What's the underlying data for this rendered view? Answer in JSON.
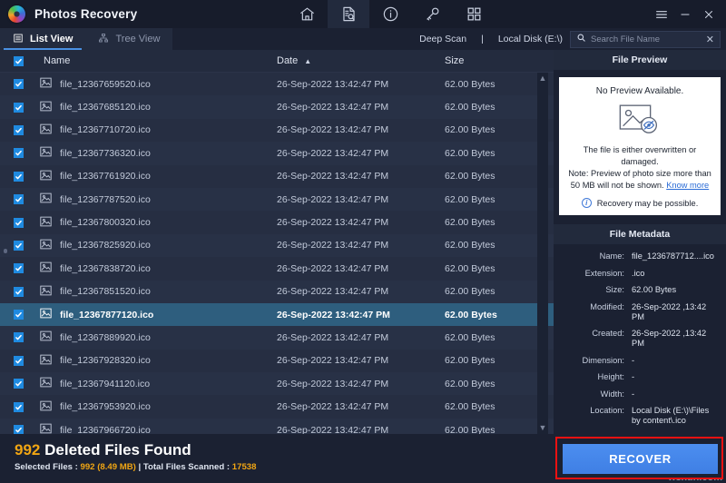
{
  "window": {
    "app_title": "Photos Recovery",
    "logo_icon": "photos-recovery-logo",
    "toolbar_icons": [
      {
        "name": "home-icon",
        "label": "Home"
      },
      {
        "name": "scan-document-icon",
        "label": "Scan",
        "active": true
      },
      {
        "name": "info-icon",
        "label": "Info"
      },
      {
        "name": "key-icon",
        "label": "Registration"
      },
      {
        "name": "grid-apps-icon",
        "label": "More Tools"
      }
    ],
    "controls": {
      "menu_label": "≡",
      "minimize_label": "–",
      "close_label": "✕"
    }
  },
  "tabs": [
    {
      "label": "List View",
      "icon": "list-view-icon",
      "active": true
    },
    {
      "label": "Tree View",
      "icon": "tree-view-icon",
      "active": false
    }
  ],
  "scanbar": {
    "scan_mode": "Deep Scan",
    "separator": "|",
    "drive": "Local Disk (E:\\)",
    "search": {
      "icon": "search-icon",
      "placeholder": "Search File Name",
      "value": "",
      "clear_label": "✕"
    }
  },
  "table": {
    "select_all_checked": true,
    "columns": {
      "name": "Name",
      "date": "Date",
      "size": "Size",
      "sort_indicator": "▲",
      "sorted_by": "Date",
      "sort_direction": "ascending"
    },
    "rows": [
      {
        "checked": true,
        "name": "file_12367659520.ico",
        "date": "26-Sep-2022 13:42:47 PM",
        "size": "62.00 Bytes",
        "selected": false
      },
      {
        "checked": true,
        "name": "file_12367685120.ico",
        "date": "26-Sep-2022 13:42:47 PM",
        "size": "62.00 Bytes",
        "selected": false
      },
      {
        "checked": true,
        "name": "file_12367710720.ico",
        "date": "26-Sep-2022 13:42:47 PM",
        "size": "62.00 Bytes",
        "selected": false
      },
      {
        "checked": true,
        "name": "file_12367736320.ico",
        "date": "26-Sep-2022 13:42:47 PM",
        "size": "62.00 Bytes",
        "selected": false
      },
      {
        "checked": true,
        "name": "file_12367761920.ico",
        "date": "26-Sep-2022 13:42:47 PM",
        "size": "62.00 Bytes",
        "selected": false
      },
      {
        "checked": true,
        "name": "file_12367787520.ico",
        "date": "26-Sep-2022 13:42:47 PM",
        "size": "62.00 Bytes",
        "selected": false
      },
      {
        "checked": true,
        "name": "file_12367800320.ico",
        "date": "26-Sep-2022 13:42:47 PM",
        "size": "62.00 Bytes",
        "selected": false
      },
      {
        "checked": true,
        "name": "file_12367825920.ico",
        "date": "26-Sep-2022 13:42:47 PM",
        "size": "62.00 Bytes",
        "selected": false
      },
      {
        "checked": true,
        "name": "file_12367838720.ico",
        "date": "26-Sep-2022 13:42:47 PM",
        "size": "62.00 Bytes",
        "selected": false
      },
      {
        "checked": true,
        "name": "file_12367851520.ico",
        "date": "26-Sep-2022 13:42:47 PM",
        "size": "62.00 Bytes",
        "selected": false
      },
      {
        "checked": true,
        "name": "file_12367877120.ico",
        "date": "26-Sep-2022 13:42:47 PM",
        "size": "62.00 Bytes",
        "selected": true
      },
      {
        "checked": true,
        "name": "file_12367889920.ico",
        "date": "26-Sep-2022 13:42:47 PM",
        "size": "62.00 Bytes",
        "selected": false
      },
      {
        "checked": true,
        "name": "file_12367928320.ico",
        "date": "26-Sep-2022 13:42:47 PM",
        "size": "62.00 Bytes",
        "selected": false
      },
      {
        "checked": true,
        "name": "file_12367941120.ico",
        "date": "26-Sep-2022 13:42:47 PM",
        "size": "62.00 Bytes",
        "selected": false
      },
      {
        "checked": true,
        "name": "file_12367953920.ico",
        "date": "26-Sep-2022 13:42:47 PM",
        "size": "62.00 Bytes",
        "selected": false
      },
      {
        "checked": true,
        "name": "file_12367966720.ico",
        "date": "26-Sep-2022 13:42:47 PM",
        "size": "62.00 Bytes",
        "selected": false
      }
    ]
  },
  "preview": {
    "section_title": "File Preview",
    "headline": "No Preview Available.",
    "icon": "broken-image-icon",
    "line1": "The file is either overwritten or",
    "line2": "damaged.",
    "line3": "Note: Preview of photo size more than",
    "line4": "50 MB will not be shown.",
    "link": "Know more",
    "note_icon": "info-circle-icon",
    "note": "Recovery may be possible."
  },
  "metadata": {
    "section_title": "File Metadata",
    "fields": [
      {
        "key": "Name:",
        "value": "file_1236787712....ico"
      },
      {
        "key": "Extension:",
        "value": ".ico"
      },
      {
        "key": "Size:",
        "value": "62.00 Bytes"
      },
      {
        "key": "Modified:",
        "value": "26-Sep-2022 ,13:42 PM"
      },
      {
        "key": "Created:",
        "value": "26-Sep-2022 ,13:42 PM"
      },
      {
        "key": "Dimension:",
        "value": "-"
      },
      {
        "key": "Height:",
        "value": "-"
      },
      {
        "key": "Width:",
        "value": "-"
      },
      {
        "key": "Location:",
        "value": "Local Disk (E:\\)\\Files by content\\.ico"
      }
    ]
  },
  "status": {
    "deleted_count": "992",
    "deleted_label": "Deleted Files Found",
    "selected_prefix": "Selected Files : ",
    "selected_value": "992 (8.49 MB)",
    "divider": " | ",
    "total_prefix": "Total Files Scanned : ",
    "total_value": "17538"
  },
  "actions": {
    "recover_label": "RECOVER",
    "highlight_color": "#ee1111",
    "button_color": "#4c8ef0"
  },
  "watermark": "wsxdn.com"
}
